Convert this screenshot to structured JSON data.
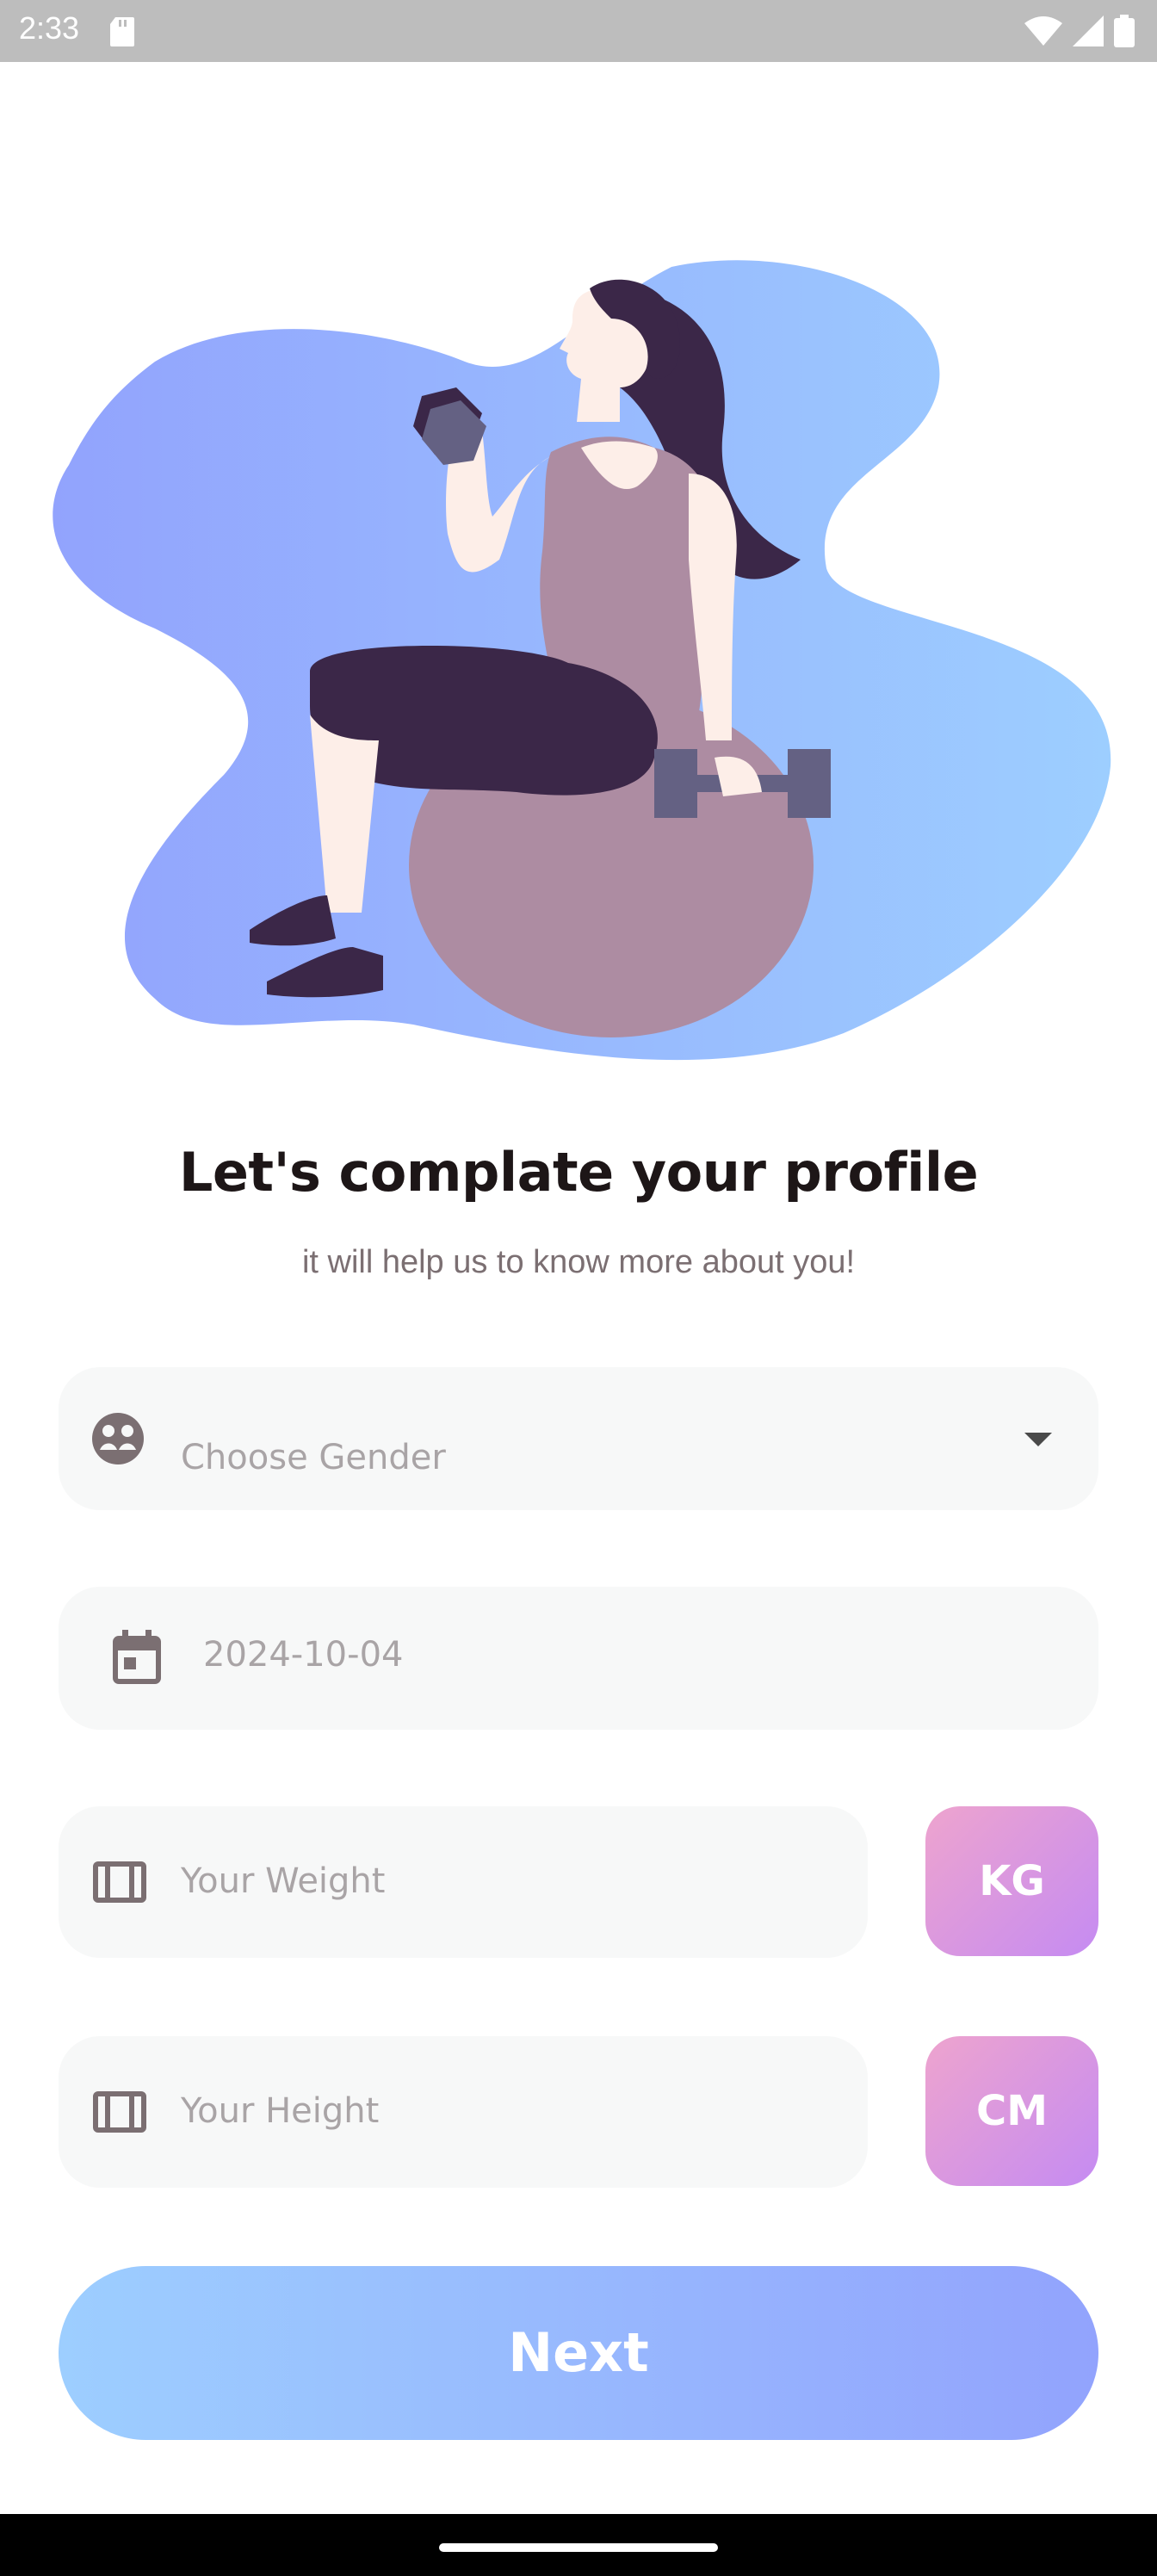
{
  "status_bar": {
    "time": "2:33",
    "icons": [
      "sd-card-icon",
      "wifi-icon",
      "signal-icon",
      "battery-icon"
    ]
  },
  "hero": {
    "illustration": "woman-exercising-with-dumbbells-on-ball",
    "colors": {
      "blob_start": "#92a3fd",
      "blob_end": "#9dceff",
      "ball": "#ad8ca2",
      "hair": "#3b2748"
    }
  },
  "title": "Let's complate your profile",
  "subtitle": "it will help us to know more about you!",
  "form": {
    "gender": {
      "placeholder": "Choose Gender",
      "icon": "gender-icon"
    },
    "dob": {
      "value": "2024-10-04",
      "icon": "calendar-icon"
    },
    "weight": {
      "placeholder": "Your Weight",
      "icon": "weight-scale-icon",
      "unit": "KG"
    },
    "height": {
      "placeholder": "Your Height",
      "icon": "ruler-icon",
      "unit": "CM"
    }
  },
  "next_label": "Next",
  "colors": {
    "primary_gradient": [
      "#9dceff",
      "#92a3fd"
    ],
    "secondary_gradient": [
      "#eea4ce",
      "#c58bf2"
    ],
    "field_bg": "#f7f8f8",
    "text_dark": "#1d1617",
    "text_gray": "#7b6f72"
  }
}
